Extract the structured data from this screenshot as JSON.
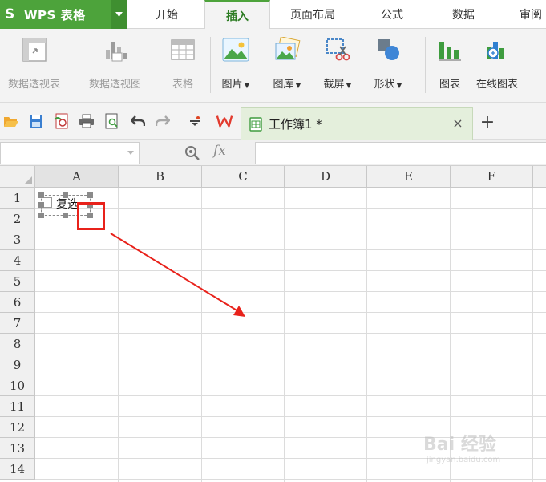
{
  "app": {
    "title": "WPS 表格",
    "logo_glyph": "S",
    "accent_color": "#4da33b"
  },
  "menu_tabs": [
    {
      "label": "开始",
      "active": false
    },
    {
      "label": "插入",
      "active": true
    },
    {
      "label": "页面布局",
      "active": false
    },
    {
      "label": "公式",
      "active": false
    },
    {
      "label": "数据",
      "active": false
    },
    {
      "label": "审阅",
      "active": false
    }
  ],
  "ribbon": {
    "pivot_table": {
      "label": "数据透视表",
      "icon": "pivot-table-icon",
      "enabled": false
    },
    "pivot_chart": {
      "label": "数据透视图",
      "icon": "pivot-chart-icon",
      "enabled": false
    },
    "table": {
      "label": "表格",
      "icon": "table-icon",
      "enabled": false
    },
    "picture": {
      "label": "图片",
      "icon": "picture-icon",
      "has_dropdown": true
    },
    "gallery": {
      "label": "图库",
      "icon": "gallery-icon",
      "has_dropdown": true
    },
    "screenshot": {
      "label": "截屏",
      "icon": "screenshot-icon",
      "has_dropdown": true
    },
    "shape": {
      "label": "形状",
      "icon": "shape-icon",
      "has_dropdown": true
    },
    "chart": {
      "label": "图表",
      "icon": "bar-chart-icon"
    },
    "online_chart": {
      "label": "在线图表",
      "icon": "online-chart-icon"
    }
  },
  "quick_access": [
    "open-folder-icon",
    "save-icon",
    "export-pdf-icon",
    "print-icon",
    "print-preview-icon",
    "undo-icon",
    "redo-icon",
    "customize-dropdown-icon",
    "wps-logo-icon"
  ],
  "document_tab": {
    "name": "工作簿1 *",
    "close_glyph": "×",
    "new_tab_glyph": "+"
  },
  "formula_bar": {
    "name_box_value": "",
    "fx_label": "fx",
    "formula_value": ""
  },
  "sheet": {
    "columns": [
      "A",
      "B",
      "C",
      "D",
      "E",
      "F"
    ],
    "rows": [
      "1",
      "2",
      "3",
      "4",
      "5",
      "6",
      "7",
      "8",
      "9",
      "10",
      "11",
      "12",
      "13",
      "14"
    ],
    "selected_column": "A"
  },
  "checkbox_control": {
    "label": "复选",
    "checked": false
  },
  "annotation": {
    "highlight_color": "#e8221b"
  },
  "watermark": {
    "main": "Bai 经验",
    "sub": "jingyan.baidu.com"
  }
}
